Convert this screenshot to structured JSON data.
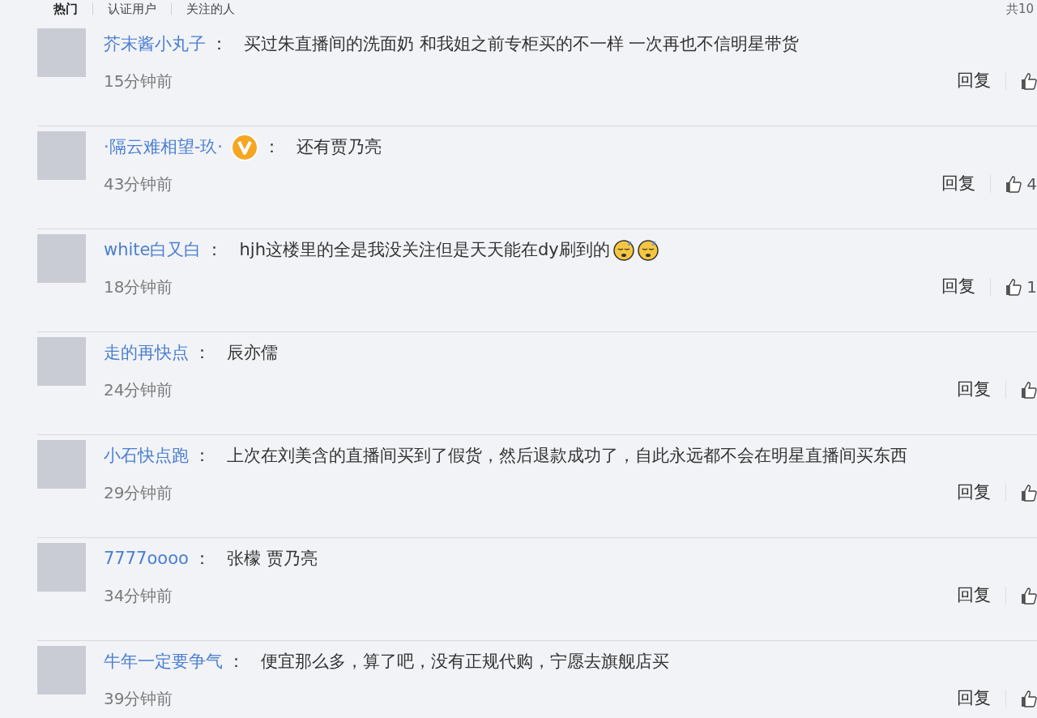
{
  "tabs": [
    {
      "label": "热门",
      "selected": true
    },
    {
      "label": "认证用户",
      "selected": false
    },
    {
      "label": "关注的人",
      "selected": false
    }
  ],
  "total": "共10",
  "comments": [
    {
      "user": "芥末酱小丸子",
      "verified": false,
      "separator": "：",
      "text": "买过朱直播间的洗面奶 和我姐之前专柜买的不一样 一次再也不信明星带货",
      "time": "15分钟前",
      "reply": "回复"
    },
    {
      "user": "·隔云难相望-玖·",
      "verified": true,
      "separator": "：",
      "text": "还有贾乃亮",
      "time": "43分钟前",
      "reply": "回复",
      "likes": "4"
    },
    {
      "user": "white白又白",
      "verified": false,
      "separator": "：",
      "text": "hjh这楼里的全是我没关注但是天天能在dy刷到的",
      "emojis": [
        {
          "kind": "sleepy"
        },
        {
          "kind": "sleepy"
        }
      ],
      "time": "18分钟前",
      "reply": "回复",
      "likes": "1"
    },
    {
      "user": "走的再快点",
      "verified": false,
      "separator": "：",
      "text": "辰亦儒",
      "time": "24分钟前",
      "reply": "回复"
    },
    {
      "user": "小石快点跑",
      "verified": false,
      "separator": "：",
      "text": "上次在刘美含的直播间买到了假货，然后退款成功了，自此永远都不会在明星直播间买东西",
      "time": "29分钟前",
      "reply": "回复"
    },
    {
      "user": "7777oooo",
      "verified": false,
      "separator": "：",
      "text": "张檬 贾乃亮",
      "time": "34分钟前",
      "reply": "回复"
    },
    {
      "user": "牛年一定要争气",
      "verified": false,
      "separator": "：",
      "text": "便宜那么多，算了吧，没有正规代购，宁愿去旗舰店买",
      "time": "39分钟前",
      "reply": "回复"
    }
  ]
}
